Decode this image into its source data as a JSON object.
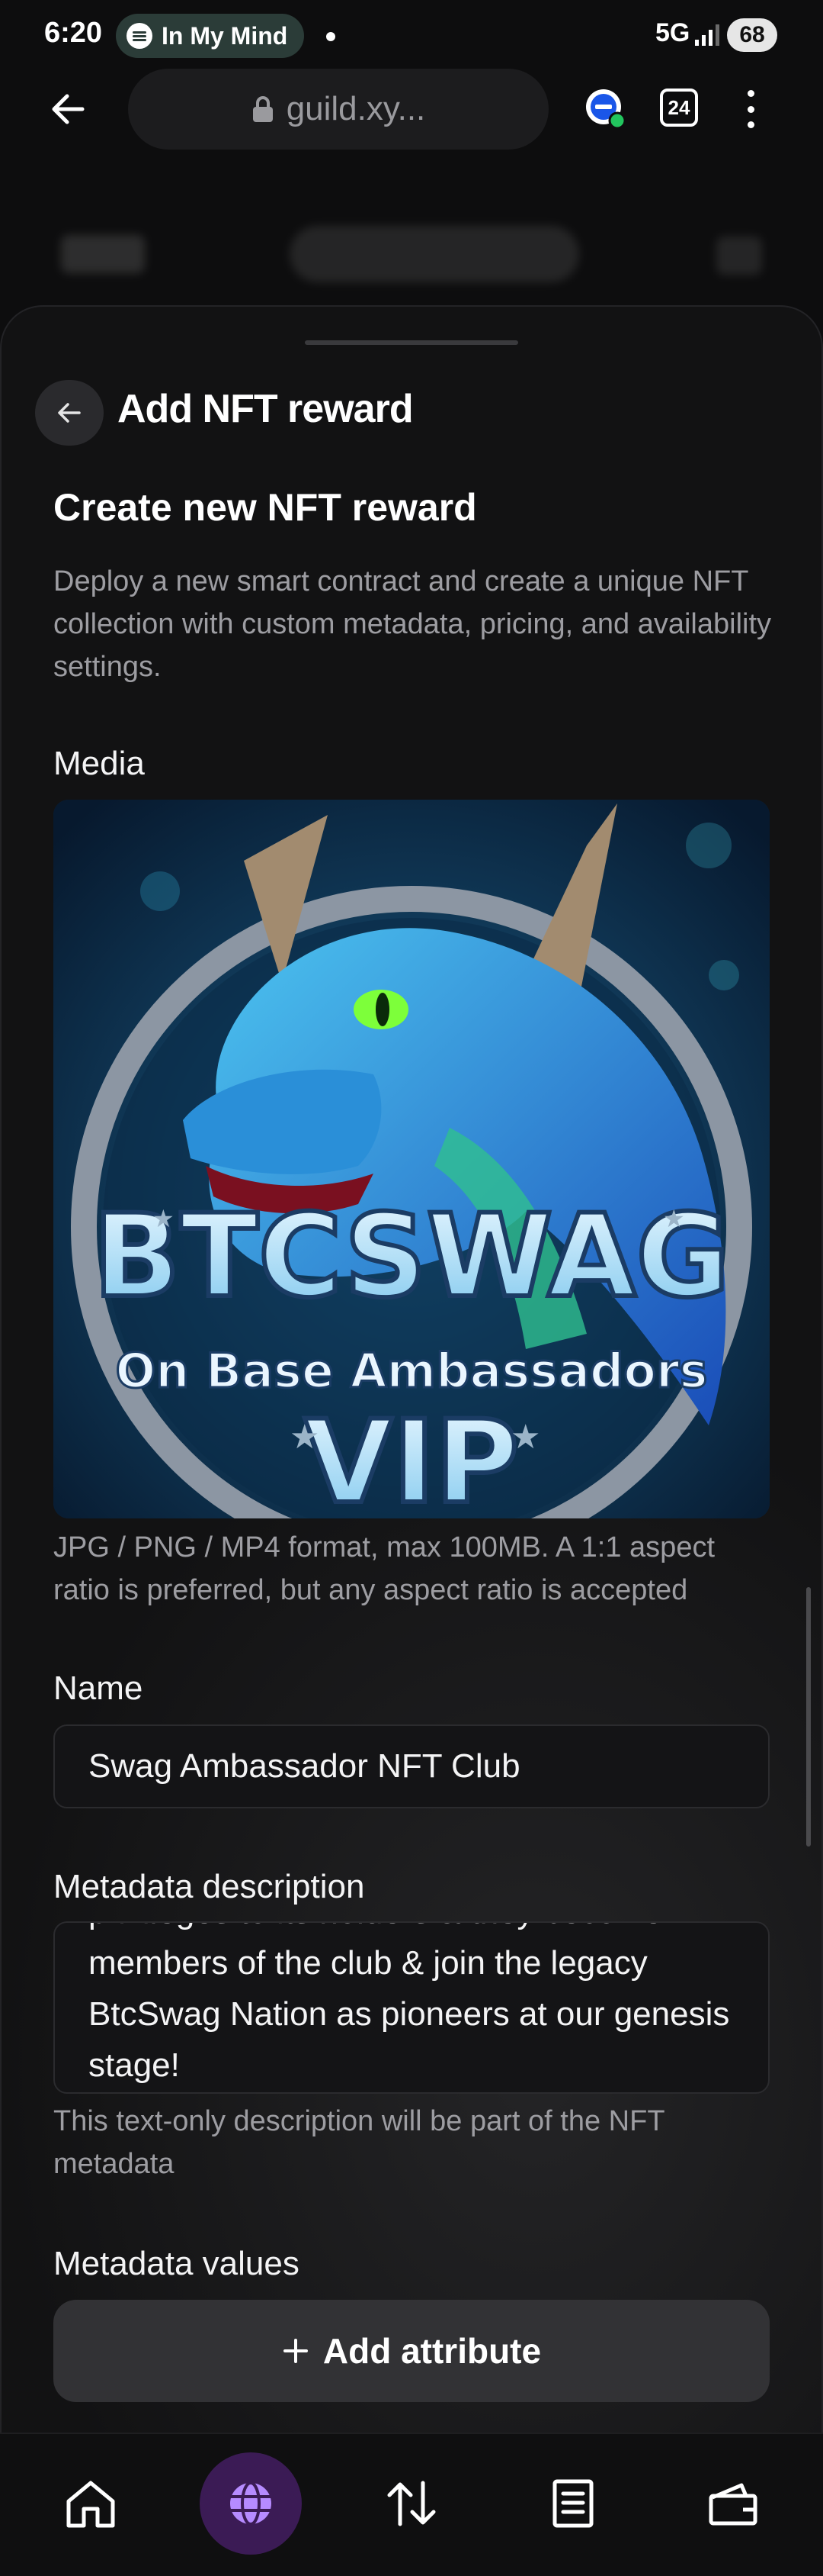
{
  "status_bar": {
    "time": "6:20",
    "media_chip_label": "In My Mind",
    "network": "5G",
    "battery": "68"
  },
  "browser": {
    "url": "guild.xy...",
    "tab_count": "24"
  },
  "sheet": {
    "title": "Add NFT reward",
    "section_title": "Create new NFT reward",
    "section_description": "Deploy a new smart contract and create a unique NFT collection with custom metadata, pricing, and availability settings.",
    "media": {
      "label": "Media",
      "hint": "JPG / PNG / MP4 format, max 100MB. A 1:1 aspect ratio is preferred, but any aspect ratio is accepted",
      "image_text": {
        "line1": "BTCSWAG",
        "line2": "On Base Ambassadors",
        "line3": "VIP"
      }
    },
    "name": {
      "label": "Name",
      "value": "Swag Ambassador NFT Club"
    },
    "metadata_description": {
      "label": "Metadata description",
      "value": "privileges to its holders & they become members of the club & join the legacy BtcSwag Nation as pioneers at our genesis stage!",
      "hint": "This text-only description will be part of the NFT metadata"
    },
    "metadata_values": {
      "label": "Metadata values",
      "add_button": "Add attribute"
    }
  },
  "bottom_nav": {
    "items": [
      "home",
      "browser",
      "transfer",
      "activity",
      "wallet"
    ],
    "active": "browser",
    "accent_color": "#7c3aed"
  },
  "colors": {
    "background": "#0d0d0e",
    "sheet": "#121213",
    "muted_text": "#9d9da2",
    "media_chip": "#2b3c38"
  }
}
